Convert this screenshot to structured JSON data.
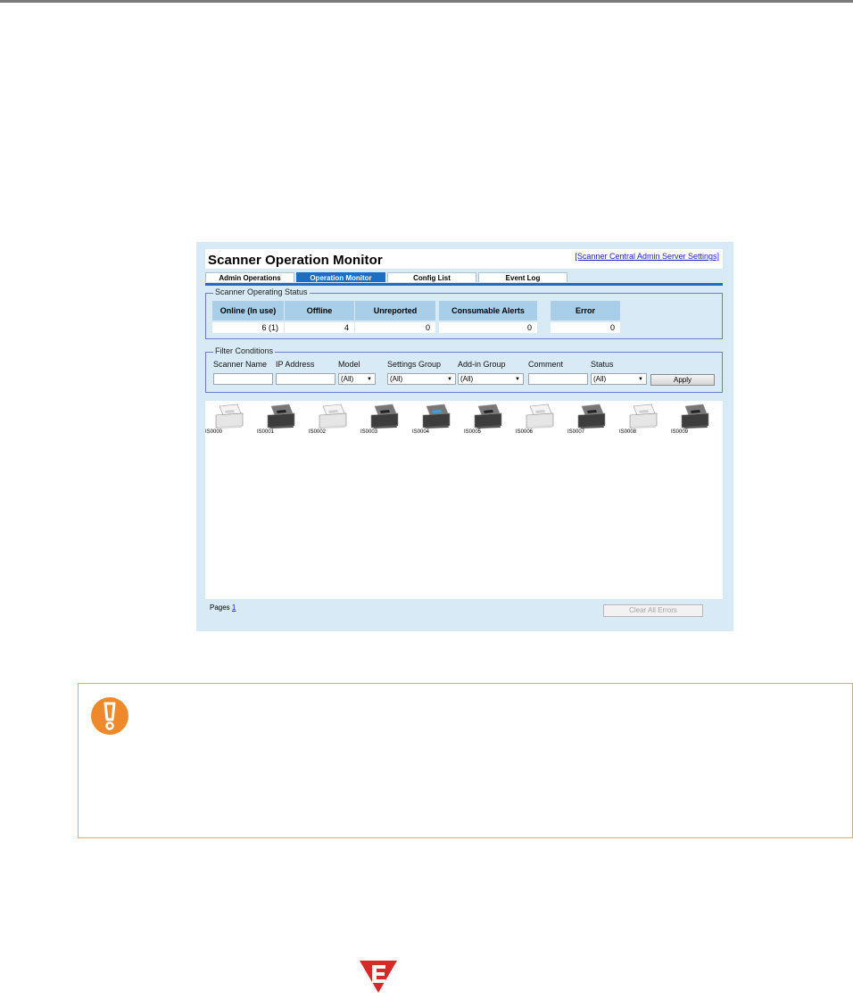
{
  "app": {
    "title": "Scanner Operation Monitor",
    "settings_link": "[Scanner Central Admin Server Settings]"
  },
  "tabs": [
    {
      "label": "Admin Operations",
      "active": false
    },
    {
      "label": "Operation Monitor",
      "active": true
    },
    {
      "label": "Config List",
      "active": false
    },
    {
      "label": "Event Log",
      "active": false
    }
  ],
  "status": {
    "legend": "Scanner Operating Status",
    "headers": [
      "Online (In use)",
      "Offline",
      "Unreported",
      "Consumable Alerts",
      "Error"
    ],
    "values": [
      "6 (1)",
      "4",
      "0",
      "0",
      "0"
    ]
  },
  "filter": {
    "legend": "Filter Conditions",
    "labels": [
      "Scanner Name",
      "IP Address",
      "Model",
      "Settings Group",
      "Add-in Group",
      "Comment",
      "Status"
    ],
    "scanner_name": "",
    "ip_address": "",
    "model": "(All)",
    "settings_group": "(All)",
    "addin_group": "(All)",
    "comment": "",
    "status": "(All)",
    "apply_label": "Apply"
  },
  "scanners": [
    {
      "name": "IS0000",
      "state": "offline"
    },
    {
      "name": "IS0001",
      "state": "online"
    },
    {
      "name": "IS0002",
      "state": "offline"
    },
    {
      "name": "IS0003",
      "state": "online"
    },
    {
      "name": "IS0004",
      "state": "in-use"
    },
    {
      "name": "IS0005",
      "state": "online"
    },
    {
      "name": "IS0006",
      "state": "offline"
    },
    {
      "name": "IS0007",
      "state": "online"
    },
    {
      "name": "IS0008",
      "state": "offline"
    },
    {
      "name": "IS0009",
      "state": "online"
    }
  ],
  "footer": {
    "pages_label": "Pages",
    "page_number": "1",
    "clear_label": "Clear All Errors"
  },
  "colors": {
    "accent": "#1a6fc4",
    "panel_bg": "#d7eaf6",
    "caution_border": "#f0a355",
    "caution_icon": "#ef8a2c",
    "e_mark": "#d42a2a"
  },
  "icons": {
    "caution": "caution-icon",
    "e_mark": "e-mark-icon"
  }
}
